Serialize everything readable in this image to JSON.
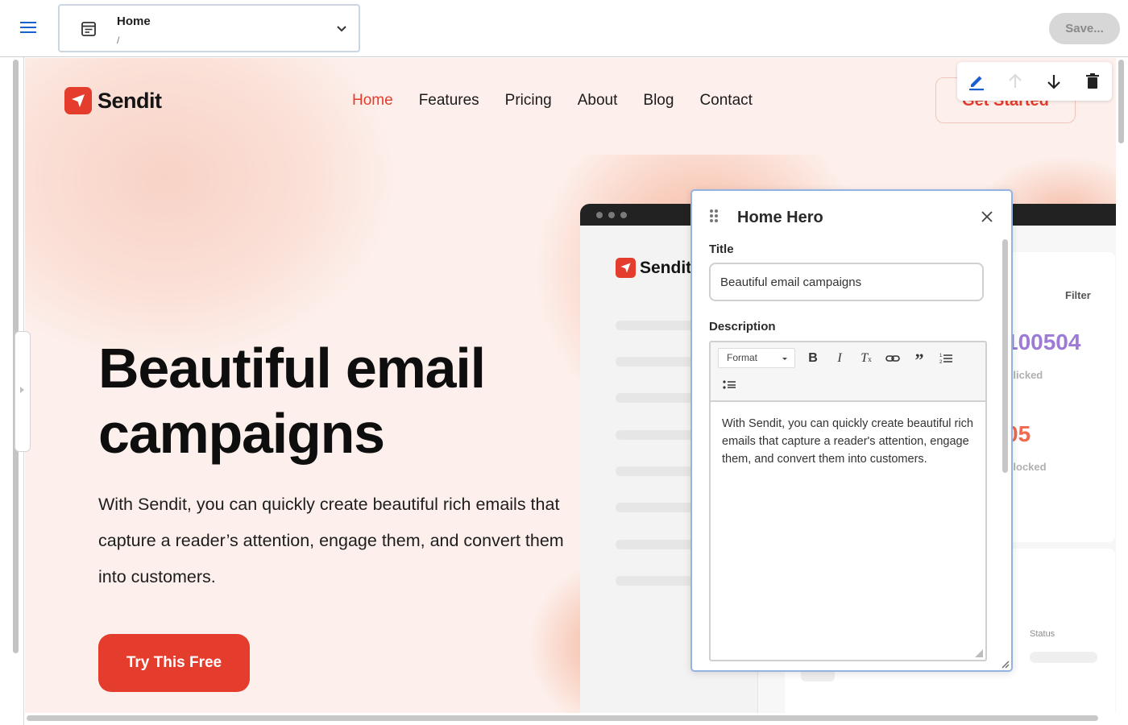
{
  "toolbar": {
    "menu_icon": "hamburger-menu-icon",
    "page_select": {
      "name": "Home",
      "path": "/",
      "icon": "page-icon",
      "chevron": "chevron-down-icon"
    },
    "save_label": "Save..."
  },
  "site": {
    "brand": "Sendit",
    "nav": [
      {
        "label": "Home",
        "active": true
      },
      {
        "label": "Features",
        "active": false
      },
      {
        "label": "Pricing",
        "active": false
      },
      {
        "label": "About",
        "active": false
      },
      {
        "label": "Blog",
        "active": false
      },
      {
        "label": "Contact",
        "active": false
      }
    ],
    "cta_top": "Get Started",
    "hero": {
      "title": "Beautiful email campaigns",
      "description": "With Sendit, you can quickly create beautiful rich emails that capture a reader’s attention, engage them, and convert them into customers.",
      "button": "Try This Free"
    },
    "mockup": {
      "brand": "Sendit",
      "filter": "Filter",
      "stat1_value": "100504",
      "stat1_label": "Clicked",
      "stat2_value": "05",
      "stat2_label": "Blocked",
      "status_header": "Status"
    },
    "colors": {
      "brand": "#e43d2e",
      "accent_blue": "#1a5fd0",
      "stat_purple": "#9c7ad6",
      "stat_orange": "#ef6a4e"
    }
  },
  "block_toolbar": {
    "edit_icon": "pencil-edit-icon",
    "move_up_icon": "arrow-up-icon",
    "move_down_icon": "arrow-down-icon",
    "delete_icon": "trash-icon"
  },
  "panel": {
    "title": "Home Hero",
    "drag_icon": "drag-handle-icon",
    "close_icon": "close-icon",
    "title_label": "Title",
    "title_value": "Beautiful email campaigns",
    "description_label": "Description",
    "format_label": "Format",
    "rte_tools": [
      "bold-icon",
      "italic-icon",
      "clear-format-icon",
      "link-icon",
      "blockquote-icon",
      "ordered-list-icon",
      "bullet-list-icon"
    ],
    "description_value": "With Sendit, you can quickly create beautiful rich emails that capture a reader's attention, engage them, and convert them into customers."
  }
}
